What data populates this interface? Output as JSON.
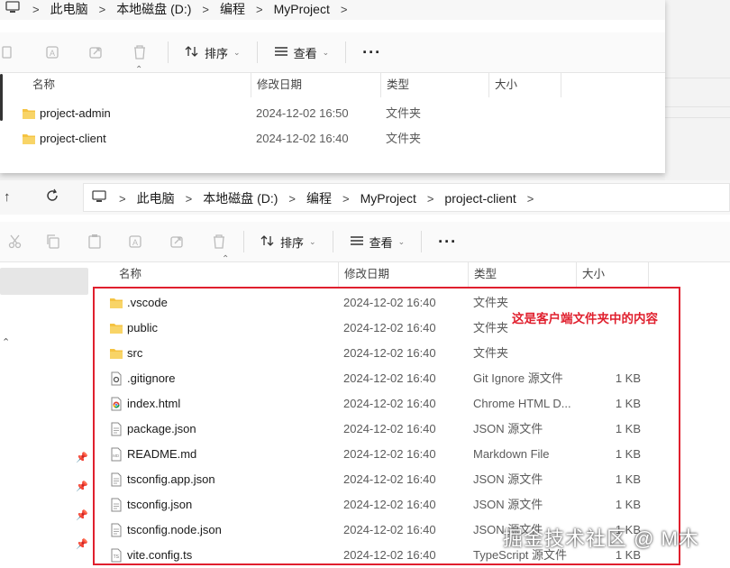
{
  "window_top": {
    "breadcrumb": [
      "此电脑",
      "本地磁盘 (D:)",
      "编程",
      "MyProject"
    ],
    "toolbar": {
      "sort_label": "排序",
      "view_label": "查看"
    },
    "columns": [
      "名称",
      "修改日期",
      "类型",
      "大小"
    ],
    "rows": [
      {
        "name": "project-admin",
        "date": "2024-12-02 16:50",
        "type": "文件夹",
        "size": ""
      },
      {
        "name": "project-client",
        "date": "2024-12-02 16:40",
        "type": "文件夹",
        "size": ""
      }
    ]
  },
  "window_main": {
    "breadcrumb": [
      "此电脑",
      "本地磁盘 (D:)",
      "编程",
      "MyProject",
      "project-client"
    ],
    "toolbar": {
      "sort_label": "排序",
      "view_label": "查看"
    },
    "columns": [
      "名称",
      "修改日期",
      "类型",
      "大小"
    ],
    "rows": [
      {
        "name": ".vscode",
        "date": "2024-12-02 16:40",
        "type": "文件夹",
        "size": "",
        "icon": "folder-icon"
      },
      {
        "name": "public",
        "date": "2024-12-02 16:40",
        "type": "文件夹",
        "size": "",
        "icon": "folder-icon"
      },
      {
        "name": "src",
        "date": "2024-12-02 16:40",
        "type": "文件夹",
        "size": "",
        "icon": "folder-icon"
      },
      {
        "name": ".gitignore",
        "date": "2024-12-02 16:40",
        "type": "Git Ignore 源文件",
        "size": "1 KB",
        "icon": "gear-file-icon"
      },
      {
        "name": "index.html",
        "date": "2024-12-02 16:40",
        "type": "Chrome HTML D...",
        "size": "1 KB",
        "icon": "chrome-icon"
      },
      {
        "name": "package.json",
        "date": "2024-12-02 16:40",
        "type": "JSON 源文件",
        "size": "1 KB",
        "icon": "file-icon"
      },
      {
        "name": "README.md",
        "date": "2024-12-02 16:40",
        "type": "Markdown File",
        "size": "1 KB",
        "icon": "markdown-file-icon"
      },
      {
        "name": "tsconfig.app.json",
        "date": "2024-12-02 16:40",
        "type": "JSON 源文件",
        "size": "1 KB",
        "icon": "file-icon"
      },
      {
        "name": "tsconfig.json",
        "date": "2024-12-02 16:40",
        "type": "JSON 源文件",
        "size": "1 KB",
        "icon": "file-icon"
      },
      {
        "name": "tsconfig.node.json",
        "date": "2024-12-02 16:40",
        "type": "JSON 源文件",
        "size": "1 KB",
        "icon": "file-icon"
      },
      {
        "name": "vite.config.ts",
        "date": "2024-12-02 16:40",
        "type": "TypeScript 源文件",
        "size": "1 KB",
        "icon": "ts-file-icon"
      }
    ]
  },
  "annotation": {
    "text": "这是客户端文件夹中的内容",
    "color": "#e0202e"
  },
  "watermark": "掘金技术社区 @ M木",
  "colors": {
    "folder": "#f5c342",
    "selection": "#e6e6e6",
    "accent_red": "#e0202e"
  }
}
